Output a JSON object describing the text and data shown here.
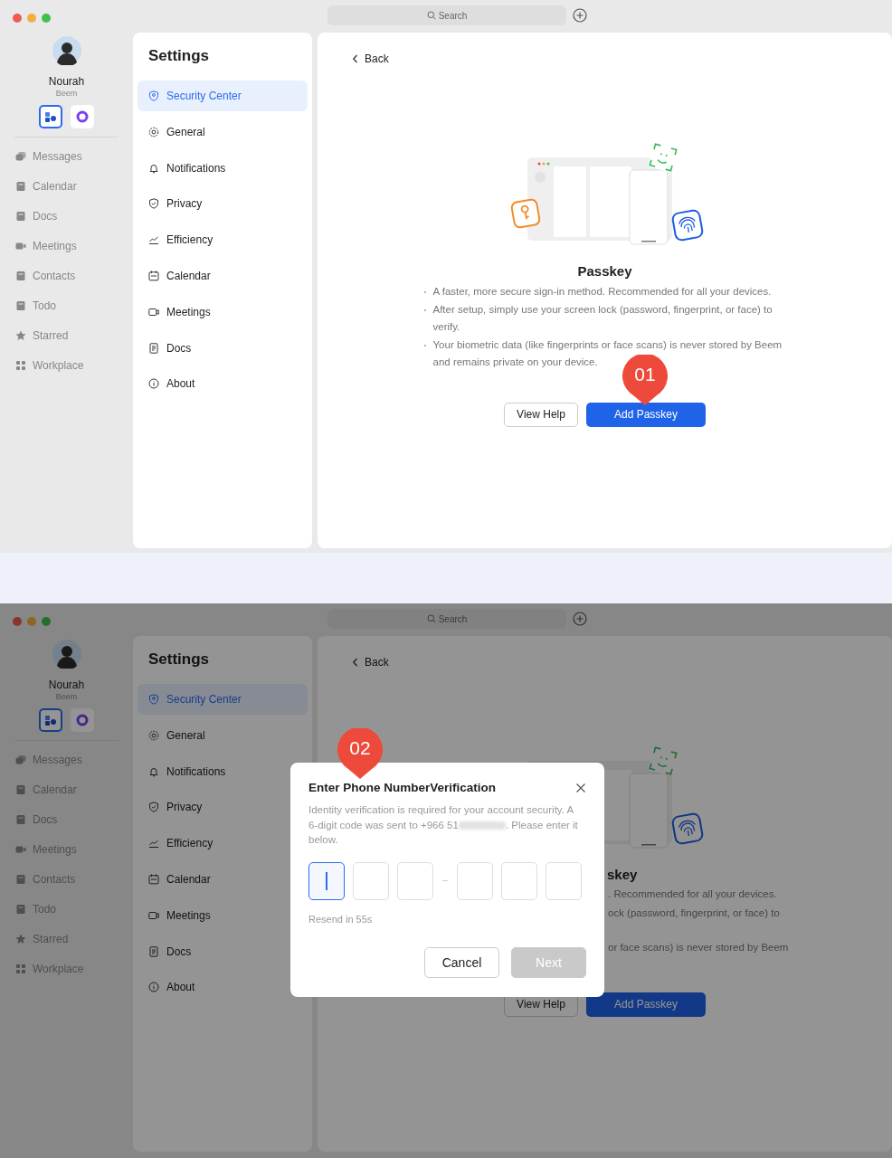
{
  "screens": [
    {
      "search_placeholder": "Search",
      "profile": {
        "name": "Nourah",
        "org": "Beem"
      },
      "apps": [
        {
          "selected": true
        },
        {
          "selected": false
        }
      ],
      "nav": [
        {
          "label": "Messages"
        },
        {
          "label": "Calendar"
        },
        {
          "label": "Docs"
        },
        {
          "label": "Meetings"
        },
        {
          "label": "Contacts"
        },
        {
          "label": "Todo"
        },
        {
          "label": "Starred"
        },
        {
          "label": "Workplace"
        }
      ],
      "settings": {
        "title": "Settings",
        "items": [
          {
            "label": "Security Center",
            "selected": true
          },
          {
            "label": "General",
            "selected": false
          },
          {
            "label": "Notifications",
            "selected": false
          },
          {
            "label": "Privacy",
            "selected": false
          },
          {
            "label": "Efficiency",
            "selected": false
          },
          {
            "label": "Calendar",
            "selected": false
          },
          {
            "label": "Meetings",
            "selected": false
          },
          {
            "label": "Docs",
            "selected": false
          },
          {
            "label": "About",
            "selected": false
          }
        ]
      },
      "main": {
        "back": "Back",
        "title": "Passkey",
        "bullets": [
          "A faster, more secure sign-in method. Recommended for all your devices.",
          "After setup, simply use your screen lock (password, fingerprint, or face) to verify.",
          "Your biometric data (like fingerprints or face scans) is never stored by Beem and remains private on your device."
        ],
        "buttons": [
          {
            "label": "View Help",
            "kind": "secondary"
          },
          {
            "label": "Add Passkey",
            "kind": "primary"
          }
        ]
      },
      "marker": "01"
    },
    {
      "search_placeholder": "Search",
      "profile": {
        "name": "Nourah",
        "org": "Beem"
      },
      "apps": [
        {
          "selected": true
        },
        {
          "selected": false
        }
      ],
      "nav": [
        {
          "label": "Messages"
        },
        {
          "label": "Calendar"
        },
        {
          "label": "Docs"
        },
        {
          "label": "Meetings"
        },
        {
          "label": "Contacts"
        },
        {
          "label": "Todo"
        },
        {
          "label": "Starred"
        },
        {
          "label": "Workplace"
        }
      ],
      "settings": {
        "title": "Settings",
        "items": [
          {
            "label": "Security Center",
            "selected": true
          },
          {
            "label": "General",
            "selected": false
          },
          {
            "label": "Notifications",
            "selected": false
          },
          {
            "label": "Privacy",
            "selected": false
          },
          {
            "label": "Efficiency",
            "selected": false
          },
          {
            "label": "Calendar",
            "selected": false
          },
          {
            "label": "Meetings",
            "selected": false
          },
          {
            "label": "Docs",
            "selected": false
          },
          {
            "label": "About",
            "selected": false
          }
        ]
      },
      "main": {
        "back": "Back",
        "title": "skey",
        "bullets": [
          ". Recommended for all your devices.",
          "ock (password, fingerprint, or face) to",
          "or face scans) is never stored by Beem"
        ],
        "buttons": [
          {
            "label": "View Help",
            "kind": "secondary"
          },
          {
            "label": "Add Passkey",
            "kind": "primary"
          }
        ]
      },
      "dialog": {
        "title": "Enter Phone NumberVerification",
        "description_before": "Identity verification is required for your account security. A 6-digit code was sent to +966 51",
        "description_after": ". Please enter it below.",
        "code_cells": [
          {
            "focused": true
          },
          {
            "focused": false
          },
          {
            "focused": false
          },
          {
            "focused": false
          },
          {
            "focused": false
          },
          {
            "focused": false
          }
        ],
        "resend": "Resend in 55s",
        "buttons": [
          {
            "label": "Cancel",
            "disabled": false
          },
          {
            "label": "Next",
            "disabled": true
          }
        ]
      },
      "marker": "02"
    }
  ]
}
